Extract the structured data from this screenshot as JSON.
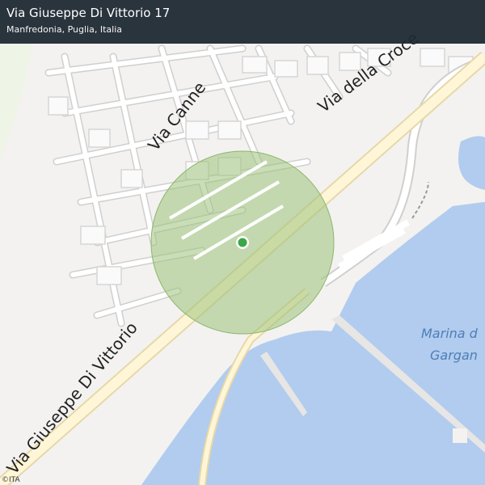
{
  "header": {
    "title": "Via Giuseppe Di Vittorio 17",
    "subtitle": "Manfredonia, Puglia, Italia"
  },
  "map": {
    "road_labels": {
      "via_canne": "Via Canne",
      "via_della_croce": "Via della Croce",
      "via_di_vittorio": "Via Giuseppe Di Vittorio"
    },
    "water_label_line1": "Marina d",
    "water_label_line2": "Gargan",
    "attribution": "©ITA",
    "colors": {
      "land": "#f3f2f0",
      "water": "#b1ccee",
      "road_fill": "#ffffff",
      "road_casing": "#cfcfcf",
      "main_road": "#fff6d8",
      "accuracy_circle": "#9cc27a",
      "marker": "#3aa845"
    }
  }
}
